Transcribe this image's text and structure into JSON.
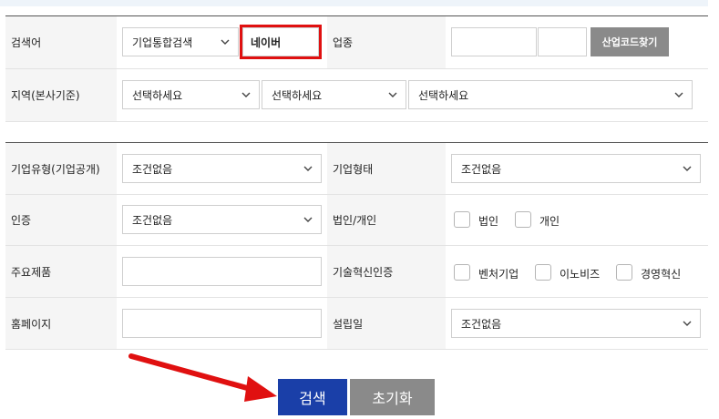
{
  "search_form": {
    "company_name": {
      "label": "검색어",
      "type_select": "기업통합검색",
      "keyword_value": "네이버"
    },
    "industry": {
      "label": "업종",
      "code_input_1": "",
      "code_input_2": "",
      "find_code_button": "산업코드찾기"
    },
    "region": {
      "label": "지역(본사기준)",
      "select_1": "선택하세요",
      "select_2": "선택하세요",
      "select_3": "선택하세요"
    }
  },
  "detail_form": {
    "company_type": {
      "label": "기업유형(기업공개)",
      "value": "조건없음"
    },
    "company_form": {
      "label": "기업형태",
      "value": "조건없음"
    },
    "certification": {
      "label": "인증",
      "value": "조건없음"
    },
    "entity_type": {
      "label": "법인/개인",
      "options": [
        "법인",
        "개인"
      ]
    },
    "main_products": {
      "label": "주요제품",
      "value": ""
    },
    "tech_innovation": {
      "label": "기술혁신인증",
      "options": [
        "벤처기업",
        "이노비즈",
        "경영혁신"
      ]
    },
    "homepage": {
      "label": "홈페이지",
      "value": ""
    },
    "established": {
      "label": "설립일",
      "value": "조건없음"
    }
  },
  "actions": {
    "search_label": "검색",
    "reset_label": "초기화"
  },
  "annotation": {
    "highlight_color": "#e01010",
    "arrow_color": "#e01010"
  }
}
